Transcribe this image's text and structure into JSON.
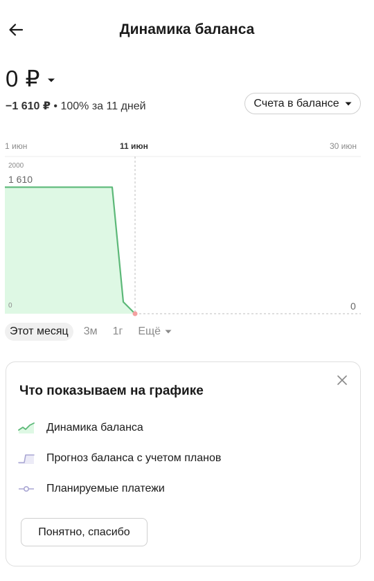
{
  "header": {
    "title": "Динамика баланса",
    "back_icon": "arrow-left-icon"
  },
  "balance": {
    "value": "0 ₽",
    "change_amount": "−1 610 ₽",
    "change_rest": " • 100% за 11 дней"
  },
  "accounts_filter": {
    "label": "Счета в балансе"
  },
  "chart_data": {
    "type": "area",
    "x_labels": [
      "1 июн",
      "11 июн",
      "30 июн"
    ],
    "highlighted_x_label": "11 июн",
    "y_labels": [
      "2000",
      "1 610",
      "0"
    ],
    "right_value_label": "0",
    "ylim": [
      0,
      2000
    ],
    "series": [
      {
        "x": [
          "1 июн",
          "2 июн",
          "3 июн",
          "4 июн",
          "5 июн",
          "6 июн",
          "7 июн",
          "8 июн",
          "9 июн",
          "10 июн",
          "11 июн"
        ],
        "values": [
          1610,
          1610,
          1610,
          1610,
          1610,
          1610,
          1610,
          1610,
          1610,
          150,
          0
        ]
      }
    ],
    "colors": {
      "line": "#5cb878",
      "fill": "#def8e4",
      "marker": "#f4a0a0",
      "grid": "#dddddd"
    }
  },
  "periods": {
    "items": [
      "Этот месяц",
      "3м",
      "1г",
      "Ещё"
    ],
    "active": "Этот месяц"
  },
  "info_card": {
    "title": "Что показываем на графике",
    "legend": [
      {
        "label": "Динамика баланса",
        "icon": "balance-trend-icon"
      },
      {
        "label": "Прогноз баланса с учетом планов",
        "icon": "forecast-step-icon"
      },
      {
        "label": "Планируемые платежи",
        "icon": "planned-payments-icon"
      }
    ],
    "button_label": "Понятно, спасибо",
    "close_icon": "close-icon"
  }
}
